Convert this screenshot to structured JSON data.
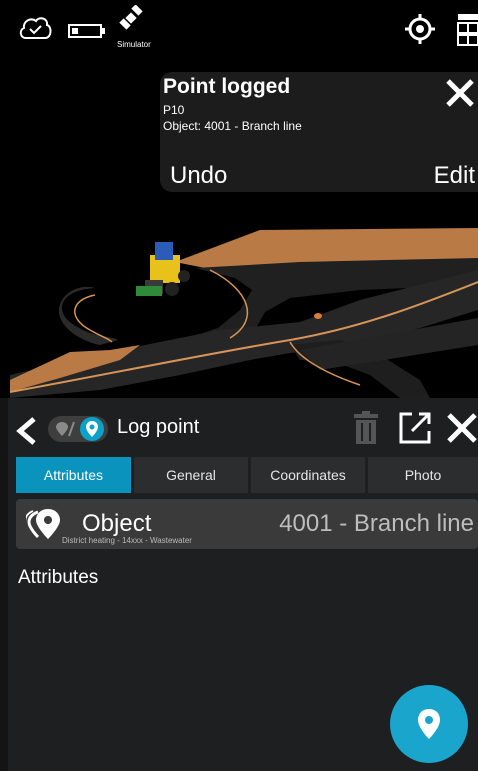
{
  "status_bar": {
    "simulator_label": "Simulator",
    "icons": [
      "cloud-check-icon",
      "battery-icon",
      "satellite-icon",
      "target-icon",
      "layers-icon"
    ]
  },
  "toast": {
    "title": "Point logged",
    "point_id": "P10",
    "object_line": "Object: 4001 - Branch line",
    "undo_label": "Undo",
    "edit_label": "Edit"
  },
  "panel": {
    "title": "Log point",
    "tabs": [
      {
        "label": "Attributes",
        "active": true
      },
      {
        "label": "General",
        "active": false
      },
      {
        "label": "Coordinates",
        "active": false
      },
      {
        "label": "Photo",
        "active": false
      }
    ],
    "object": {
      "label": "Object",
      "value": "4001 - Branch line",
      "subtitle": "District heating - 14xxx - Wastewater"
    },
    "attributes_heading": "Attributes"
  },
  "colors": {
    "accent": "#0a93bd",
    "fab": "#1aa5cd",
    "road_edge": "#c8864a",
    "panel_bg": "#1e1f21"
  }
}
